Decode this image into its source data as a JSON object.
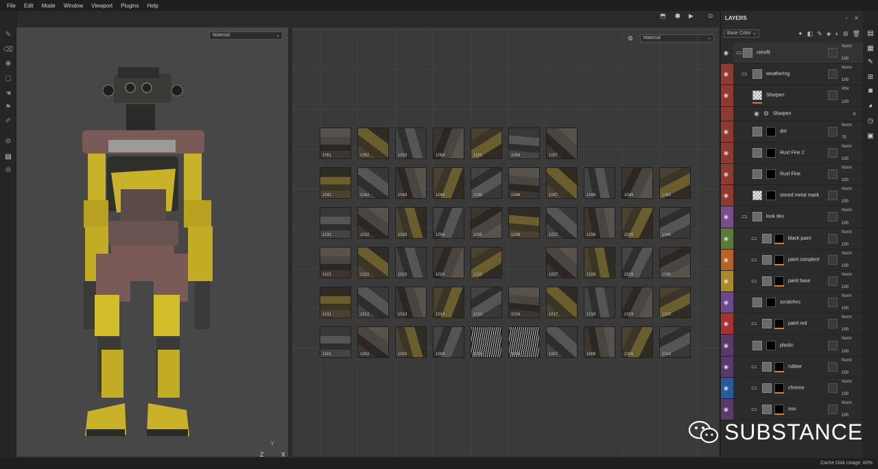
{
  "menu": [
    "File",
    "Edit",
    "Mode",
    "Window",
    "Viewport",
    "Plugins",
    "Help"
  ],
  "viewport": {
    "material_select": "Material",
    "uv_material_select": "Material",
    "axis_label": "Z",
    "axis_x": "X",
    "axis_y": "Y"
  },
  "uv_tiles": {
    "row1": [
      "1051",
      "1052",
      "1053",
      "1054",
      "1055",
      "1056",
      "1057"
    ],
    "row2": [
      "1041",
      "1042",
      "1043",
      "1044",
      "1045",
      "1046",
      "1047",
      "1048",
      "1049",
      "1050"
    ],
    "row3": [
      "1031",
      "1032",
      "1033",
      "1034",
      "1035",
      "1036",
      "1037",
      "1038",
      "1039",
      "1040"
    ],
    "row4": [
      "1021",
      "1022",
      "1023",
      "1024",
      "1025",
      "",
      "1027",
      "1028",
      "1029",
      "1030"
    ],
    "row5": [
      "1011",
      "1012",
      "1013",
      "1014",
      "1015",
      "1016",
      "1017",
      "1018",
      "1019",
      "1020"
    ],
    "row6": [
      "1001",
      "1002",
      "1003",
      "1004",
      "1005",
      "1006",
      "1007",
      "1008",
      "1009",
      "1010"
    ]
  },
  "layers": {
    "title": "LAYERS",
    "channel_select": "Base Color",
    "items": [
      {
        "name": "retrofit",
        "blend": "Norm",
        "opacity": "100",
        "color": "#2b2b2b",
        "type": "group"
      },
      {
        "name": "weathering",
        "blend": "Norm",
        "opacity": "100",
        "color": "#8f3a30",
        "type": "group"
      },
      {
        "name": "Sharpen",
        "blend": "Pthr",
        "opacity": "100",
        "color": "#8f3a30",
        "type": "filter"
      },
      {
        "name": "Sharpen",
        "blend": "",
        "opacity": "",
        "color": "#8f3a30",
        "type": "sub"
      },
      {
        "name": "dirt",
        "blend": "Norm",
        "opacity": "75",
        "color": "#8f3a30",
        "type": "fill"
      },
      {
        "name": "Rust Fine 2",
        "blend": "Norm",
        "opacity": "100",
        "color": "#8f3a30",
        "type": "fill"
      },
      {
        "name": "Rust Fine",
        "blend": "Norm",
        "opacity": "100",
        "color": "#8f3a30",
        "type": "fill"
      },
      {
        "name": "stored metal mask",
        "blend": "Norm",
        "opacity": "100",
        "color": "#8f3a30",
        "type": "checker"
      },
      {
        "name": "look dev",
        "blend": "Norm",
        "opacity": "100",
        "color": "#7a4e8a",
        "type": "group"
      },
      {
        "name": "black paint",
        "blend": "Norm",
        "opacity": "100",
        "color": "#5a7a3a",
        "type": "folder"
      },
      {
        "name": "paint complent",
        "blend": "Norm",
        "opacity": "100",
        "color": "#b8622a",
        "type": "folder"
      },
      {
        "name": "paint base",
        "blend": "Norm",
        "opacity": "100",
        "color": "#a88a2a",
        "type": "folder"
      },
      {
        "name": "scratches",
        "blend": "Norm",
        "opacity": "100",
        "color": "#6a4a8a",
        "type": "fill"
      },
      {
        "name": "paint red",
        "blend": "Norm",
        "opacity": "100",
        "color": "#a83232",
        "type": "folder"
      },
      {
        "name": "plastic",
        "blend": "Norm",
        "opacity": "100",
        "color": "#5a3a6a",
        "type": "fill"
      },
      {
        "name": "rubber",
        "blend": "Norm",
        "opacity": "100",
        "color": "#5a3a6a",
        "type": "folder"
      },
      {
        "name": "chrome",
        "blend": "Norm",
        "opacity": "100",
        "color": "#2a5a9a",
        "type": "folder"
      },
      {
        "name": "iron",
        "blend": "Norm",
        "opacity": "100",
        "color": "#5a3a6a",
        "type": "folder"
      }
    ]
  },
  "status": {
    "cache": "Cache Disk Usage:",
    "cache_value": "83%"
  },
  "watermark": "SUBSTANCE"
}
